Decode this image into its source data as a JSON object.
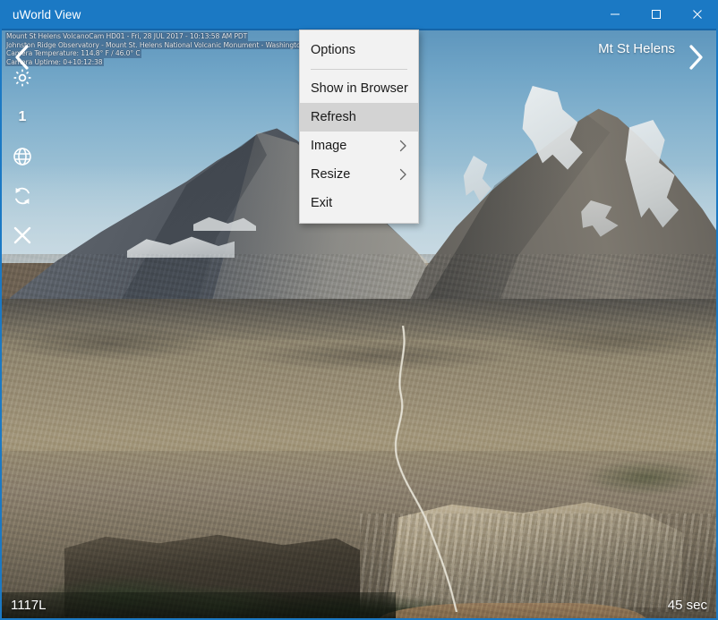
{
  "window": {
    "title": "uWorld View",
    "controls": [
      {
        "name": "minimize",
        "glyph": "minimize-icon"
      },
      {
        "name": "maximize",
        "glyph": "maximize-icon"
      },
      {
        "name": "close",
        "glyph": "close-icon"
      }
    ],
    "accent_color": "#1b79c4"
  },
  "camera": {
    "name": "Mt St Helens",
    "caption_lines": [
      "Mount St Helens VolcanoCam HD01 - Fri, 28 JUL 2017 - 10:13:58 AM PDT",
      "Johnston Ridge Observatory - Mount St. Helens National Volcanic Monument - Washington State",
      "Camera Temperature: 114.8° F / 46.0° C",
      "Camera Uptime: 0+10:12:38"
    ]
  },
  "toolbar": {
    "items": [
      {
        "icon": "gear-icon",
        "label": ""
      },
      {
        "icon": "number-label",
        "label": "1"
      },
      {
        "icon": "globe-icon",
        "label": ""
      },
      {
        "icon": "refresh-icon",
        "label": ""
      },
      {
        "icon": "close-x-icon",
        "label": ""
      }
    ]
  },
  "nav": {
    "prev_icon": "chevron-left-icon",
    "next_icon": "chevron-right-icon"
  },
  "status": {
    "left": "1117L",
    "right": "45 sec"
  },
  "context_menu": {
    "items": [
      {
        "label": "Options",
        "submenu": false,
        "highlighted": false
      },
      {
        "separator": true
      },
      {
        "label": "Show in Browser",
        "submenu": false,
        "highlighted": false
      },
      {
        "label": "Refresh",
        "submenu": false,
        "highlighted": true
      },
      {
        "label": "Image",
        "submenu": true,
        "highlighted": false
      },
      {
        "label": "Resize",
        "submenu": true,
        "highlighted": false
      },
      {
        "label": "Exit",
        "submenu": false,
        "highlighted": false
      }
    ],
    "highlight_color": "#d3d3d3",
    "background_color": "#f2f2f2"
  }
}
